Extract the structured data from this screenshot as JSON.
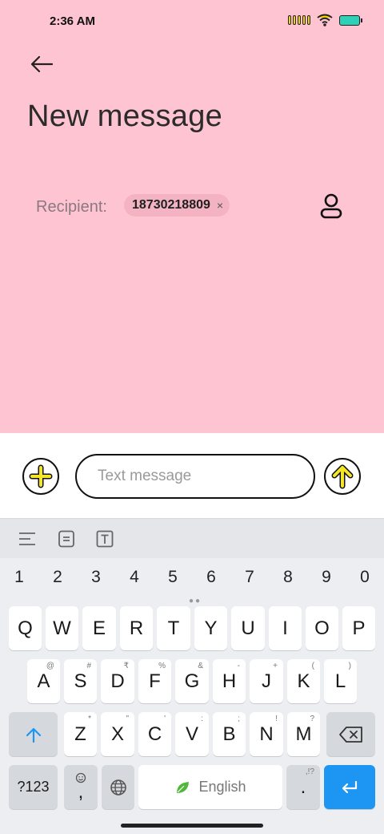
{
  "status_bar": {
    "time": "2:36 AM"
  },
  "header": {
    "title": "New message"
  },
  "recipient": {
    "label": "Recipient:",
    "chip_value": "18730218809",
    "chip_remove": "×"
  },
  "compose": {
    "placeholder": "Text message"
  },
  "keyboard": {
    "numbers": [
      "1",
      "2",
      "3",
      "4",
      "5",
      "6",
      "7",
      "8",
      "9",
      "0"
    ],
    "row1": [
      "Q",
      "W",
      "E",
      "R",
      "T",
      "Y",
      "U",
      "I",
      "O",
      "P"
    ],
    "row2": [
      "A",
      "S",
      "D",
      "F",
      "G",
      "H",
      "J",
      "K",
      "L"
    ],
    "row2_sup": [
      "@",
      "#",
      "₹",
      "%",
      "&",
      "-",
      "+",
      "(",
      ")"
    ],
    "row3": [
      "Z",
      "X",
      "C",
      "V",
      "B",
      "N",
      "M"
    ],
    "row3_sup": [
      "*",
      "\"",
      "'",
      ":",
      ";",
      "!",
      "?"
    ],
    "symbols_label": "?123",
    "comma_label": ",",
    "space_label": "English",
    "period_label": ".",
    "period_sup": ",!?"
  },
  "colors": {
    "background": "#ffc4d2",
    "accent": "#f5e625",
    "enter": "#1d96f3"
  }
}
